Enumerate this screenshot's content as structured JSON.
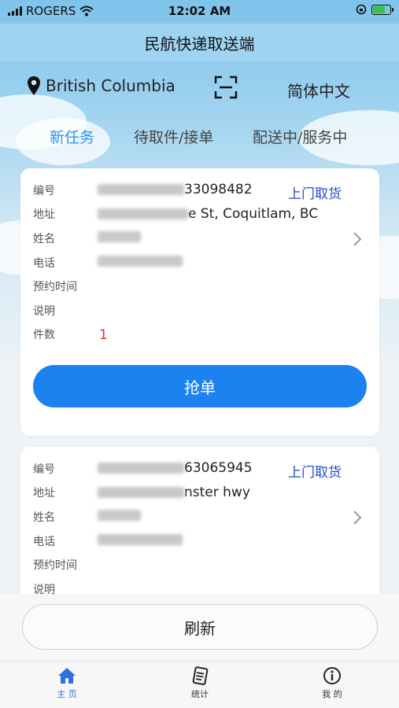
{
  "status_bar": {
    "carrier": "ROGERS",
    "time": "12:02 AM"
  },
  "header": {
    "title": "民航快递取送端"
  },
  "toolbar": {
    "location": "British Columbia",
    "language": "简体中文"
  },
  "tabs": [
    {
      "label": "新任务",
      "active": true
    },
    {
      "label": "待取件/接单",
      "active": false
    },
    {
      "label": "配送中/服务中",
      "active": false
    }
  ],
  "field_labels": {
    "number": "编号",
    "address": "地址",
    "name": "姓名",
    "phone": "电话",
    "appointment": "预约时间",
    "note": "说明",
    "pieces": "件数"
  },
  "orders": [
    {
      "number_suffix": "33098482",
      "address_suffix": "e St, Coquitlam, BC",
      "type": "上门取货",
      "pieces": "1",
      "action": "抢单"
    },
    {
      "number_suffix": "63065945",
      "address_suffix": "nster hwy",
      "type": "上门取货"
    }
  ],
  "refresh_label": "刷新",
  "tabbar": [
    {
      "label": "主 页",
      "icon": "home-icon",
      "active": true
    },
    {
      "label": "统计",
      "icon": "document-icon",
      "active": false
    },
    {
      "label": "我 的",
      "icon": "info-icon",
      "active": false
    }
  ],
  "colors": {
    "accent": "#1b82f0",
    "active_tab": "#2f93e6",
    "badge": "#2448c9",
    "count": "#e0302a",
    "header_bg": "#9ed3f2"
  }
}
